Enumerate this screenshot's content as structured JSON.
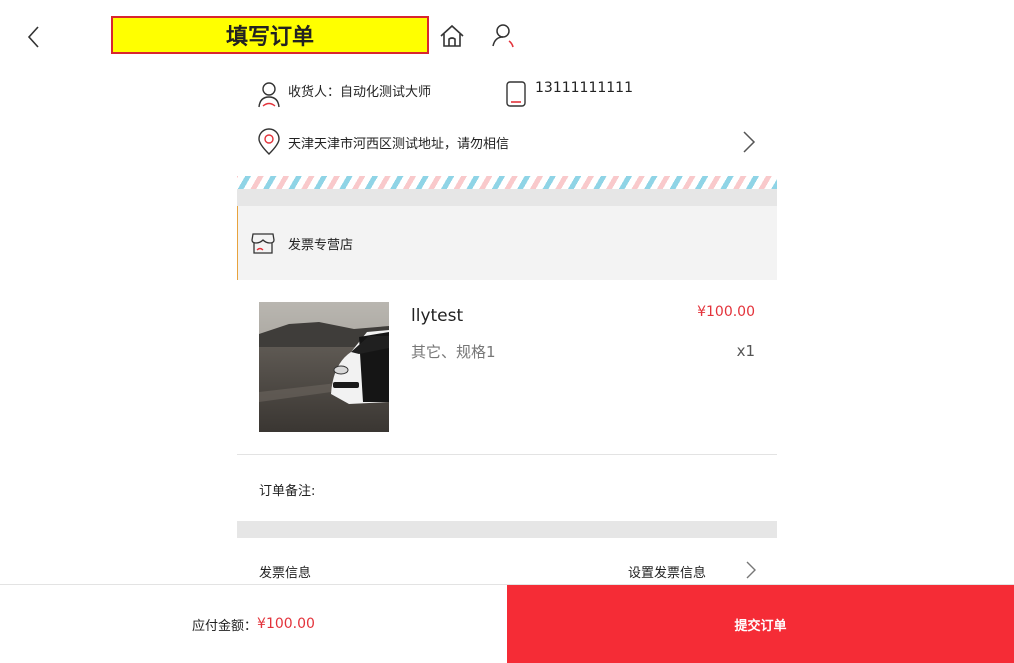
{
  "header": {
    "title": "填写订单"
  },
  "address": {
    "receiver": "收货人：自动化测试大师",
    "phone": "13111111111",
    "full_address": "天津天津市河西区测试地址，请勿相信"
  },
  "shop": {
    "name": "发票专营店"
  },
  "product": {
    "name": "llytest",
    "spec": "其它、规格1",
    "price": "¥100.00",
    "quantity": "x1"
  },
  "remark": {
    "label": "订单备注:"
  },
  "invoice": {
    "label": "发票信息",
    "action": "设置发票信息"
  },
  "footer": {
    "total_label": "应付金额：",
    "total_amount": "¥100.00",
    "submit_label": "提交订单"
  },
  "colors": {
    "accent_red": "#f52c36",
    "price_red": "#e3333b",
    "title_highlight": "#ffff00"
  },
  "icons": [
    "back-icon",
    "home-icon",
    "user-icon",
    "receiver-icon",
    "phone-icon",
    "location-pin-icon",
    "chevron-right-icon",
    "shop-icon"
  ]
}
